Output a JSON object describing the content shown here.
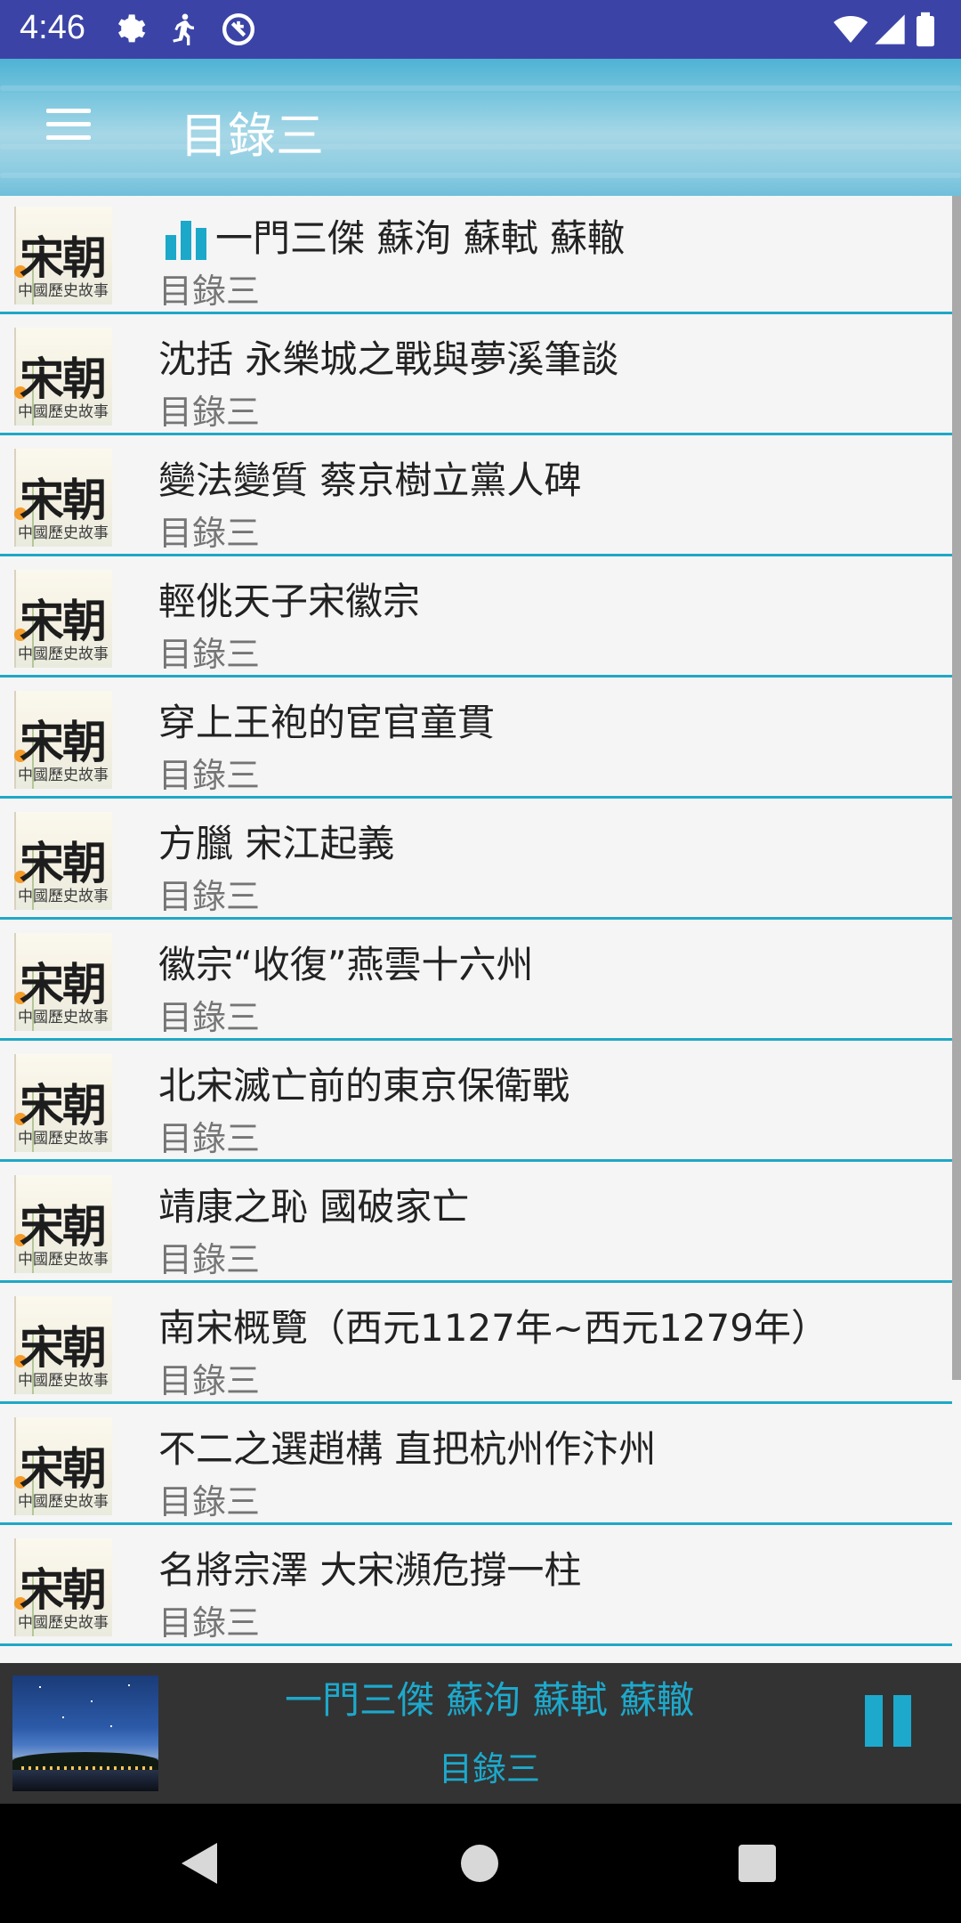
{
  "status_bar": {
    "time": "4:46",
    "icons": [
      "gear-icon",
      "running-figure-icon",
      "no-sync-icon",
      "wifi-icon",
      "cell-signal-icon",
      "battery-icon"
    ]
  },
  "app_bar": {
    "title": "目錄三",
    "menu_icon": "hamburger-menu-icon"
  },
  "thumbnail": {
    "title": "宋朝",
    "caption": "中國歷史故事"
  },
  "list": {
    "items": [
      {
        "title": "一門三傑 蘇洵 蘇軾 蘇轍",
        "subtitle": "目錄三",
        "playing": true
      },
      {
        "title": "沈括 永樂城之戰與夢溪筆談",
        "subtitle": "目錄三"
      },
      {
        "title": "變法變質 蔡京樹立黨人碑",
        "subtitle": "目錄三"
      },
      {
        "title": "輕佻天子宋徽宗",
        "subtitle": "目錄三"
      },
      {
        "title": "穿上王袍的宦官童貫",
        "subtitle": "目錄三"
      },
      {
        "title": "方臘 宋江起義",
        "subtitle": "目錄三"
      },
      {
        "title": "徽宗“收復”燕雲十六州",
        "subtitle": "目錄三"
      },
      {
        "title": "北宋滅亡前的東京保衛戰",
        "subtitle": "目錄三"
      },
      {
        "title": "靖康之恥 國破家亡",
        "subtitle": "目錄三"
      },
      {
        "title": "南宋概覽（西元1127年~西元1279年）",
        "subtitle": "目錄三"
      },
      {
        "title": "不二之選趙構 直把杭州作汴州",
        "subtitle": "目錄三"
      },
      {
        "title": "名將宗澤 大宋瀕危撐一柱",
        "subtitle": "目錄三"
      }
    ]
  },
  "player": {
    "title": "一門三傑 蘇洵 蘇軾 蘇轍",
    "subtitle": "目錄三",
    "state_icon": "pause-icon",
    "accent_color": "#1da9cc"
  },
  "nav_bar": {
    "icons": [
      "back-icon",
      "home-icon",
      "recents-icon"
    ]
  },
  "colors": {
    "status_bar": "#3b44a6",
    "divider": "#1fa8c6",
    "list_bg": "#f5f5f5",
    "player_bg": "#333333"
  }
}
